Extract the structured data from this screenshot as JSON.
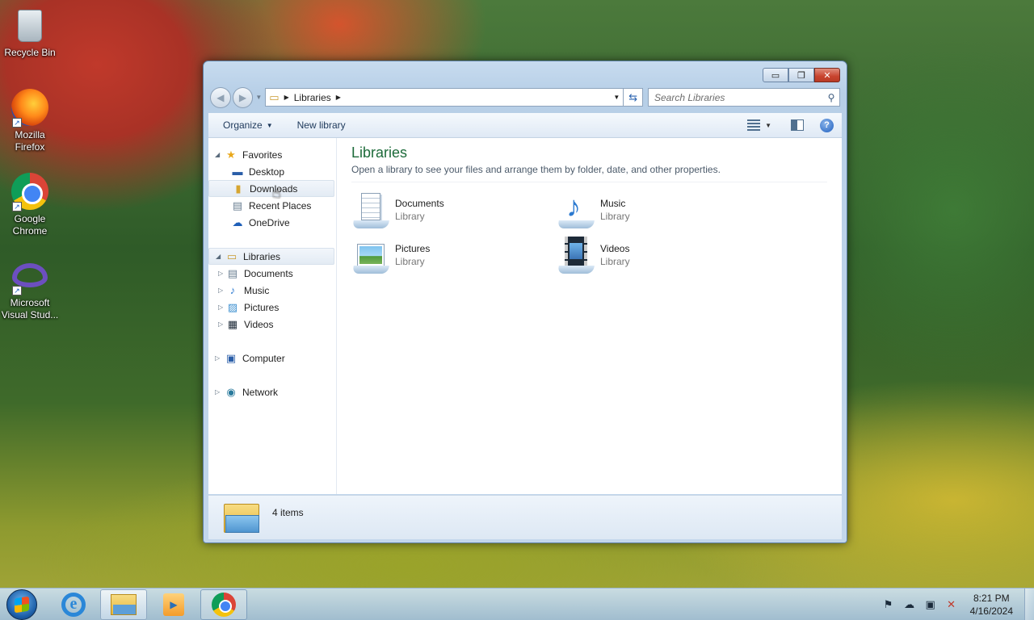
{
  "desktop": {
    "icons": [
      {
        "label": "Recycle Bin"
      },
      {
        "label": "Mozilla\nFirefox"
      },
      {
        "label": "Google\nChrome"
      },
      {
        "label": "Microsoft\nVisual Stud..."
      }
    ]
  },
  "window": {
    "controls": {
      "minimize": "▭",
      "maximize": "❐",
      "close": "✕"
    },
    "address": {
      "crumb": "Libraries"
    },
    "search": {
      "placeholder": "Search Libraries"
    },
    "toolbar": {
      "organize": "Organize",
      "new_library": "New library"
    },
    "nav": {
      "favorites": "Favorites",
      "desktop": "Desktop",
      "downloads": "Downloads",
      "recent_places": "Recent Places",
      "onedrive": "OneDrive",
      "libraries": "Libraries",
      "documents": "Documents",
      "music": "Music",
      "pictures": "Pictures",
      "videos": "Videos",
      "computer": "Computer",
      "network": "Network"
    },
    "main": {
      "title": "Libraries",
      "description": "Open a library to see your files and arrange them by folder, date, and other properties.",
      "libraries": [
        {
          "name": "Documents",
          "type": "Library"
        },
        {
          "name": "Music",
          "type": "Library"
        },
        {
          "name": "Pictures",
          "type": "Library"
        },
        {
          "name": "Videos",
          "type": "Library"
        }
      ]
    },
    "details": {
      "count": "4 items"
    }
  },
  "taskbar": {
    "clock": {
      "time": "8:21 PM",
      "date": "4/16/2024"
    }
  },
  "colors": {
    "title_green": "#1d6b3a",
    "nav_highlight": "#e3ebf4",
    "close_red": "#c8432e"
  }
}
